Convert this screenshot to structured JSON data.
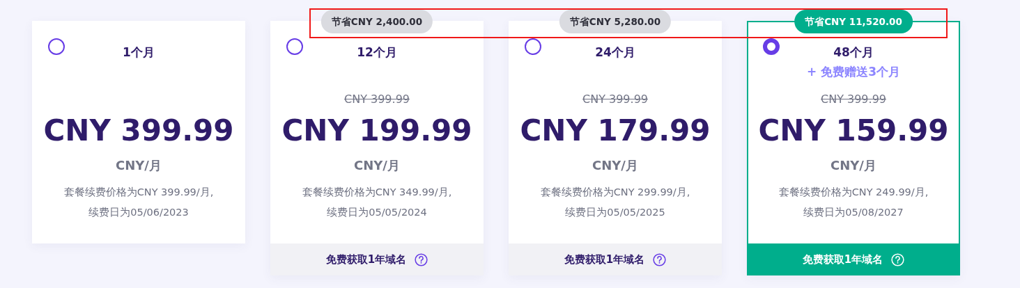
{
  "plans": [
    {
      "label": "1个月",
      "selected": false,
      "price": "CNY 399.99",
      "unit": "CNY/月",
      "renewal": [
        "套餐续费价格为CNY 399.99/月,",
        "续费日为05/06/2023"
      ]
    },
    {
      "label": "12个月",
      "selected": false,
      "savings": "节省CNY 2,400.00",
      "original_price": "CNY 399.99",
      "price": "CNY 199.99",
      "unit": "CNY/月",
      "renewal": [
        "套餐续费价格为CNY 349.99/月,",
        "续费日为05/05/2024"
      ],
      "footer": "免费获取1年域名"
    },
    {
      "label": "24个月",
      "selected": false,
      "savings": "节省CNY 5,280.00",
      "original_price": "CNY 399.99",
      "price": "CNY 179.99",
      "unit": "CNY/月",
      "renewal": [
        "套餐续费价格为CNY 299.99/月,",
        "续费日为05/05/2025"
      ],
      "footer": "免费获取1年域名"
    },
    {
      "label": "48个月",
      "selected": true,
      "savings": "节省CNY 11,520.00",
      "bonus": "+ 免费赠送3个月",
      "original_price": "CNY 399.99",
      "price": "CNY 159.99",
      "unit": "CNY/月",
      "renewal": [
        "套餐续费价格为CNY 249.99/月,",
        "续费日为05/08/2027"
      ],
      "footer": "免费获取1年域名"
    }
  ]
}
